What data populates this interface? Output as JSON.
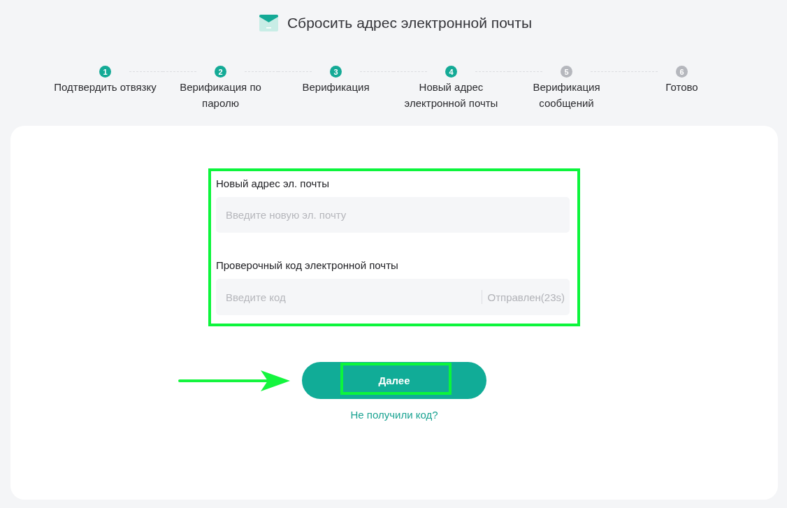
{
  "header": {
    "title": "Сбросить адрес электронной почты"
  },
  "steps": [
    {
      "number": "1",
      "label": "Подтвердить отвязку",
      "active": true
    },
    {
      "number": "2",
      "label": "Верификация по паролю",
      "active": true
    },
    {
      "number": "3",
      "label": "Верификация",
      "active": true
    },
    {
      "number": "4",
      "label": "Новый адрес электронной почты",
      "active": true
    },
    {
      "number": "5",
      "label": "Верификация сообщений",
      "active": false
    },
    {
      "number": "6",
      "label": "Готово",
      "active": false
    }
  ],
  "form": {
    "highlighted": true,
    "email_field": {
      "label": "Новый адрес эл. почты",
      "placeholder": "Введите новую эл. почту"
    },
    "code_field": {
      "label": "Проверочный код электронной почты",
      "placeholder": "Введите код",
      "send_button": {
        "label": "Отправлен(23s)",
        "disabled": true
      }
    }
  },
  "next_button": {
    "label": "Далее",
    "highlighted": true,
    "pointer_arrow": true
  },
  "help_link": {
    "label": "Не получили код?"
  }
}
